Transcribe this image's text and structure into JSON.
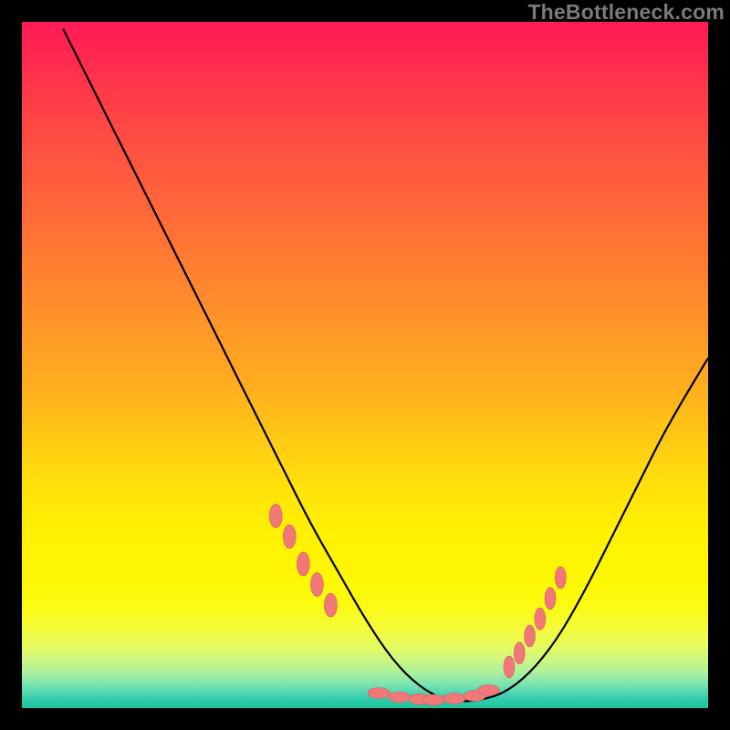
{
  "watermark": "TheBottleneck.com",
  "colors": {
    "frame": "#000000",
    "curve": "#000000",
    "marker_fill": "#f07878",
    "marker_stroke": "#d65f5f"
  },
  "chart_data": {
    "type": "line",
    "title": "",
    "xlabel": "",
    "ylabel": "",
    "xlim": [
      0,
      100
    ],
    "ylim": [
      0,
      100
    ],
    "grid": false,
    "series": [
      {
        "name": "bottleneck-curve",
        "x": [
          6,
          10,
          14,
          18,
          22,
          26,
          30,
          34,
          38,
          42,
          46,
          50,
          54,
          58,
          62,
          66,
          70,
          74,
          78,
          82,
          86,
          90,
          94,
          100
        ],
        "values": [
          99,
          91,
          83,
          75,
          67,
          59,
          51,
          43,
          35,
          27,
          20,
          13,
          7,
          3,
          1,
          1,
          2,
          5,
          10,
          17,
          25,
          33,
          41,
          51
        ]
      }
    ],
    "markers": {
      "name": "highlight-points",
      "left_arm_x": [
        37,
        39,
        41,
        43,
        45
      ],
      "left_arm_y": [
        28,
        25,
        21,
        18,
        15
      ],
      "valley_x": [
        52,
        55,
        58,
        60,
        63,
        66,
        68
      ],
      "valley_y": [
        2.2,
        1.6,
        1.3,
        1.2,
        1.4,
        1.8,
        2.6
      ],
      "right_arm_x": [
        71,
        72.5,
        74,
        75.5,
        77,
        78.5
      ],
      "right_arm_y": [
        6,
        8,
        10.5,
        13,
        16,
        19
      ]
    }
  }
}
